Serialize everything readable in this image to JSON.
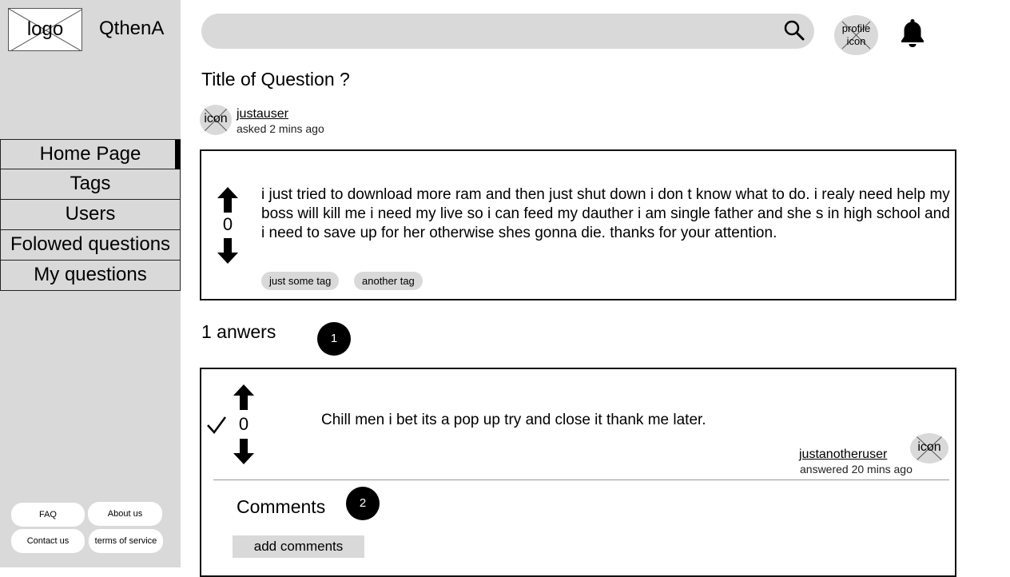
{
  "sidebar": {
    "logo_label": "logo",
    "brand": "QthenA",
    "nav": [
      {
        "label": "Home Page",
        "active": true
      },
      {
        "label": "Tags",
        "active": false
      },
      {
        "label": "Users",
        "active": false
      },
      {
        "label": "Folowed questions",
        "active": false
      },
      {
        "label": "My questions",
        "active": false
      }
    ],
    "footer": {
      "faq": "FAQ",
      "about": "About us",
      "contact": "Contact us",
      "terms": "terms of service"
    }
  },
  "header": {
    "search_placeholder": "",
    "search_icon": "search-icon",
    "profile_label_line1": "profile",
    "profile_label_line2": "icon",
    "bell_icon": "bell-icon"
  },
  "question": {
    "title": "Title of Question ?",
    "author_icon_label": "icon",
    "author": "justauser",
    "asked": "asked 2 mins ago",
    "votes": "0",
    "body": "i just tried to download more ram and then just shut down i don t  know what to do. i realy need help my boss will kill me i need my live so i can feed my dauther i am single father and she s in high school and i need to save up for her otherwise shes gonna die. thanks for your attention.",
    "tags": [
      "just some tag",
      "another tag"
    ]
  },
  "answers": {
    "title": "1 anwers",
    "count_badge": "1",
    "items": [
      {
        "votes": "0",
        "accepted": true,
        "body": "Chill men i bet its a pop up try and close it thank me later.",
        "author": "justanotheruser",
        "answered": "answered 20 mins ago",
        "author_icon_label": "icon",
        "comments_title": "Comments",
        "comments_badge": "2",
        "add_comment_label": "add comments"
      }
    ]
  },
  "colors": {
    "sidebar_bg": "#d9d9d9",
    "accent": "#000000",
    "surface": "#ffffff"
  }
}
